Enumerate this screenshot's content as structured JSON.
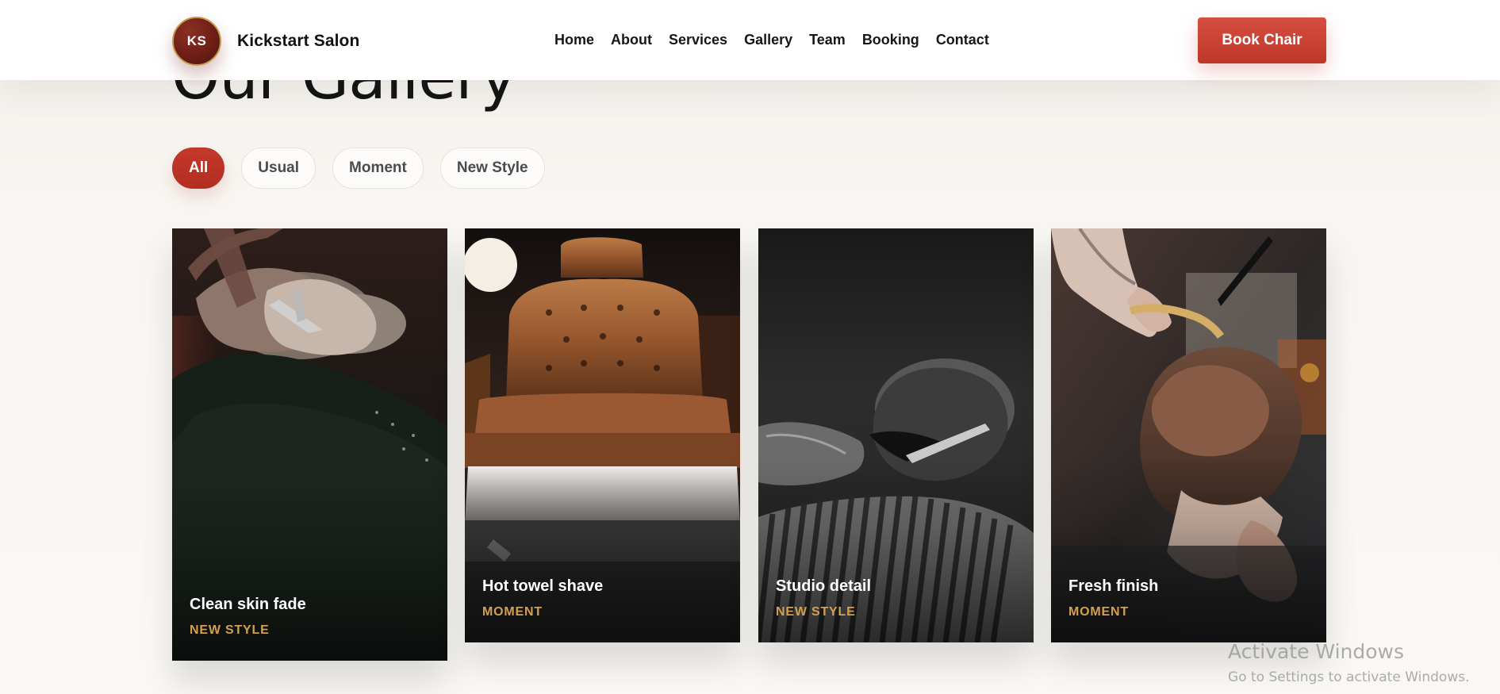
{
  "brand": {
    "initials": "KS",
    "name": "Kickstart Salon"
  },
  "nav": {
    "items": [
      "Home",
      "About",
      "Services",
      "Gallery",
      "Team",
      "Booking",
      "Contact"
    ]
  },
  "header": {
    "cta_label": "Book Chair"
  },
  "gallery": {
    "title": "Our Gallery",
    "filters": [
      "All",
      "Usual",
      "Moment",
      "New Style"
    ],
    "active_filter": "All",
    "cards": [
      {
        "title": "Clean skin fade",
        "tag": "NEW STYLE"
      },
      {
        "title": "Hot towel shave",
        "tag": "MOMENT"
      },
      {
        "title": "Studio detail",
        "tag": "NEW STYLE"
      },
      {
        "title": "Fresh finish",
        "tag": "MOMENT"
      }
    ]
  },
  "system_overlay": {
    "title": "Activate Windows",
    "subtitle": "Go to Settings to activate Windows."
  },
  "colors": {
    "accent": "#C4392B",
    "gold": "#D3A04D",
    "text": "#171717",
    "background": "#F8F6F2"
  }
}
